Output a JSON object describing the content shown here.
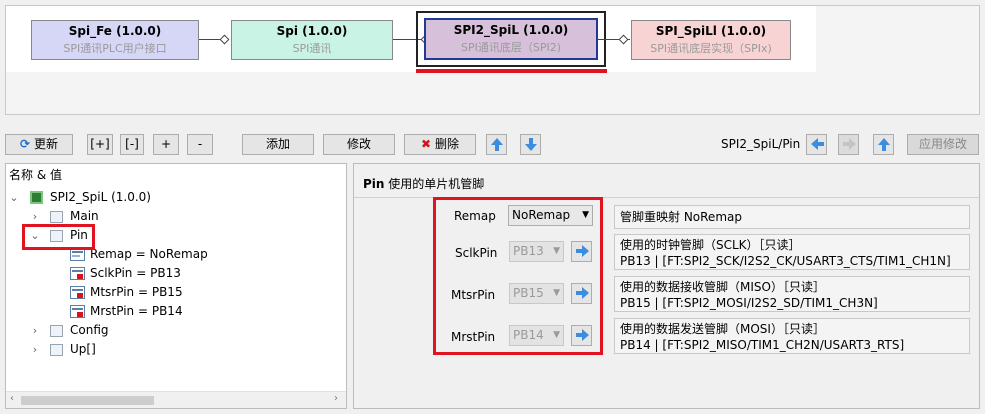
{
  "diagram": {
    "nodes": [
      {
        "title": "Spi_Fe (1.0.0)",
        "subtitle": "SPI通讯PLC用户接口",
        "fill": "#d6d6f7"
      },
      {
        "title": "Spi (1.0.0)",
        "subtitle": "SPI通讯",
        "fill": "#c9f4e5"
      },
      {
        "title": "SPI2_SpiL (1.0.0)",
        "subtitle": "SPI通讯底层（SPI2)",
        "fill": "#d7c0da"
      },
      {
        "title": "SPI_SpiLl (1.0.0)",
        "subtitle": "SPI通讯底层实现（SPIx)",
        "fill": "#f7d3d3"
      }
    ]
  },
  "toolbar": {
    "refresh": "更新",
    "expand_all": "[+]",
    "collapse_all": "[-]",
    "expand": "+",
    "collapse": "-",
    "add": "添加",
    "modify": "修改",
    "delete": "删除",
    "path": "SPI2_SpiL/Pin",
    "apply": "应用修改"
  },
  "tree": {
    "header": "名称 & 值",
    "root": "SPI2_SpiL (1.0.0)",
    "items": {
      "main": "Main",
      "pin": "Pin",
      "remap": "Remap = NoRemap",
      "sclk": "SclkPin = PB13",
      "mtsr": "MtsrPin = PB15",
      "mrst": "MrstPin = PB14",
      "config": "Config",
      "up": "Up[]"
    }
  },
  "panel": {
    "title_bold": "Pin",
    "title_rest": "使用的单片机管脚",
    "rows": {
      "remap": {
        "label": "Remap",
        "value": "NoRemap",
        "desc1": "管脚重映射 NoRemap"
      },
      "sclk": {
        "label": "SclkPin",
        "value": "PB13",
        "desc1": "使用的时钟管脚（SCLK）［只读］",
        "desc2": "PB13 | [FT:SPI2_SCK/I2S2_CK/USART3_CTS/TIM1_CH1N]"
      },
      "mtsr": {
        "label": "MtsrPin",
        "value": "PB15",
        "desc1": "使用的数据接收管脚（MISO）［只读］",
        "desc2": "PB15 | [FT:SPI2_MOSI/I2S2_SD/TIM1_CH3N]"
      },
      "mrst": {
        "label": "MrstPin",
        "value": "PB14",
        "desc1": "使用的数据发送管脚（MOSI）［只读］",
        "desc2": "PB14 | [FT:SPI2_MISO/TIM1_CH2N/USART3_RTS]"
      }
    }
  },
  "colors": {
    "highlight": "#e0141e",
    "selected_border": "#1f3a93"
  }
}
